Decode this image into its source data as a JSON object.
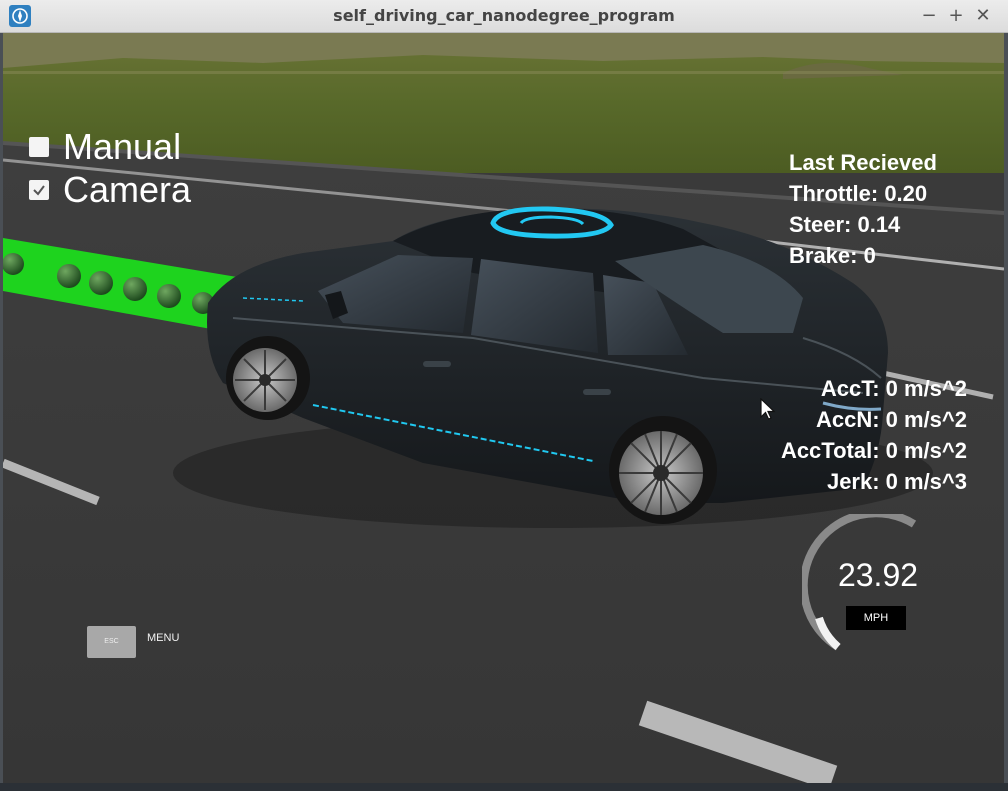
{
  "window": {
    "title": "self_driving_car_nanodegree_program",
    "min_glyph": "−",
    "max_glyph": "+",
    "close_glyph": "✕",
    "icon": "compass-icon"
  },
  "toggles": {
    "manual": {
      "label": "Manual",
      "checked": false
    },
    "camera": {
      "label": "Camera",
      "checked": true
    }
  },
  "telemetry": {
    "header": "Last Recieved",
    "throttle": "Throttle: 0.20",
    "steer": "Steer: 0.14",
    "brake": "Brake: 0"
  },
  "acceleration": {
    "acc_t": "AccT: 0 m/s^2",
    "acc_n": "AccN: 0 m/s^2",
    "acc_total": "AccTotal: 0 m/s^2",
    "jerk": "Jerk: 0 m/s^3"
  },
  "speedometer": {
    "value": "23.92",
    "unit": "MPH"
  },
  "menu": {
    "esc_label": "ESC",
    "menu_label": "MENU"
  },
  "colors": {
    "path": "#1ed31e",
    "waypoint": "#2e6a2a",
    "car_body": "#1e2226",
    "car_accent": "#20c8f0",
    "grass": "#5a6a28",
    "road": "#3c3c3c"
  }
}
